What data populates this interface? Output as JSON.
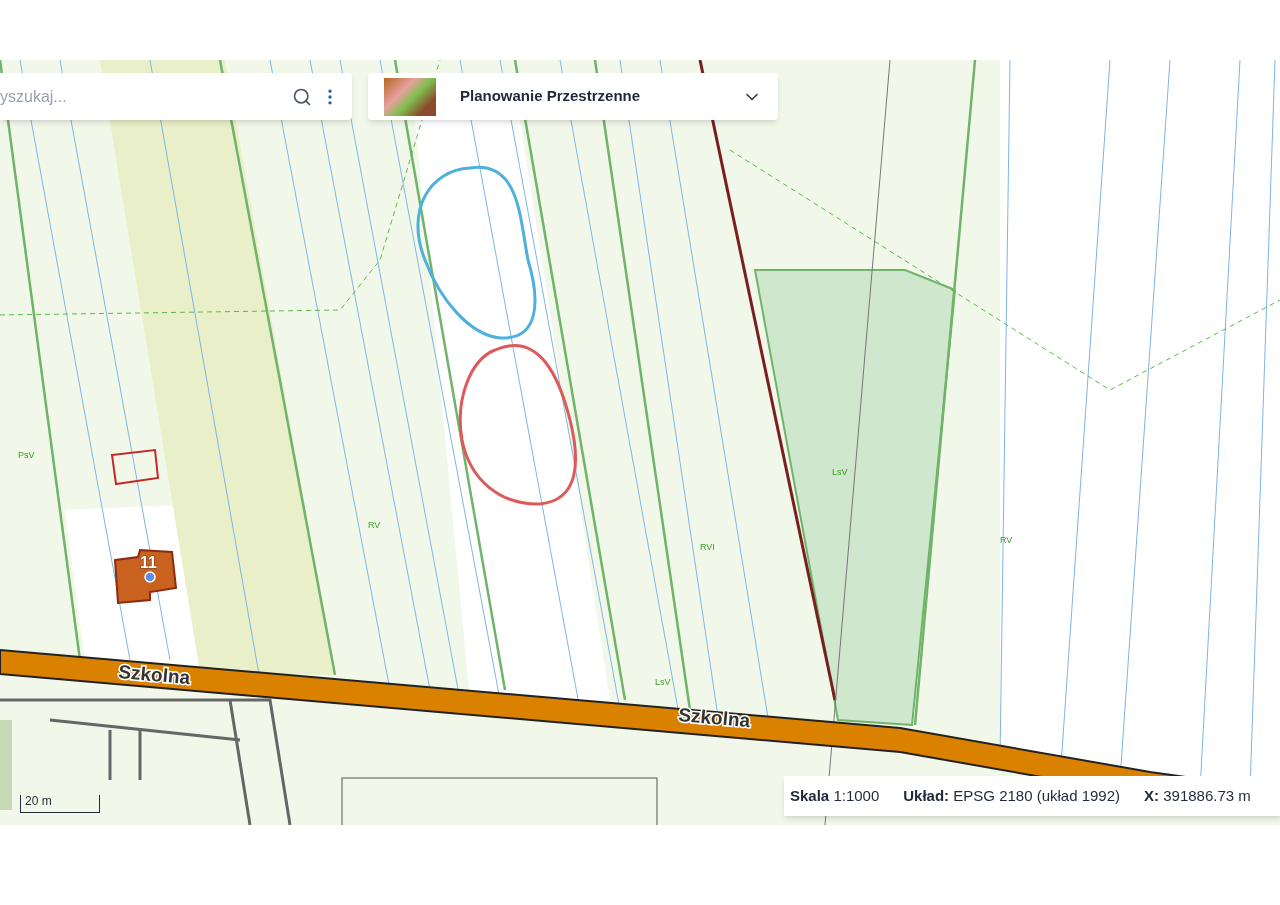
{
  "search": {
    "placeholder": "yszukaj..."
  },
  "layer_selector": {
    "label": "Planowanie Przestrzenne"
  },
  "map_labels": [
    {
      "text": "Szkolna",
      "kind": "street"
    },
    {
      "text": "Szkolna",
      "kind": "street"
    },
    {
      "text": "PsV",
      "kind": "landuse"
    },
    {
      "text": "RV",
      "kind": "landuse"
    },
    {
      "text": "RVI",
      "kind": "landuse"
    },
    {
      "text": "LsV",
      "kind": "landuse"
    },
    {
      "text": "LsV",
      "kind": "landuse"
    },
    {
      "text": "RV",
      "kind": "landuse"
    },
    {
      "text": "11",
      "kind": "house"
    }
  ],
  "scale_bar": {
    "label": "20 m"
  },
  "status_bar": [
    {
      "label": "Skala",
      "value": "1:1000"
    },
    {
      "label": "Układ:",
      "value": "EPSG 2180 (układ 1992)"
    },
    {
      "label": "X:",
      "value": "391886.73 m"
    }
  ]
}
